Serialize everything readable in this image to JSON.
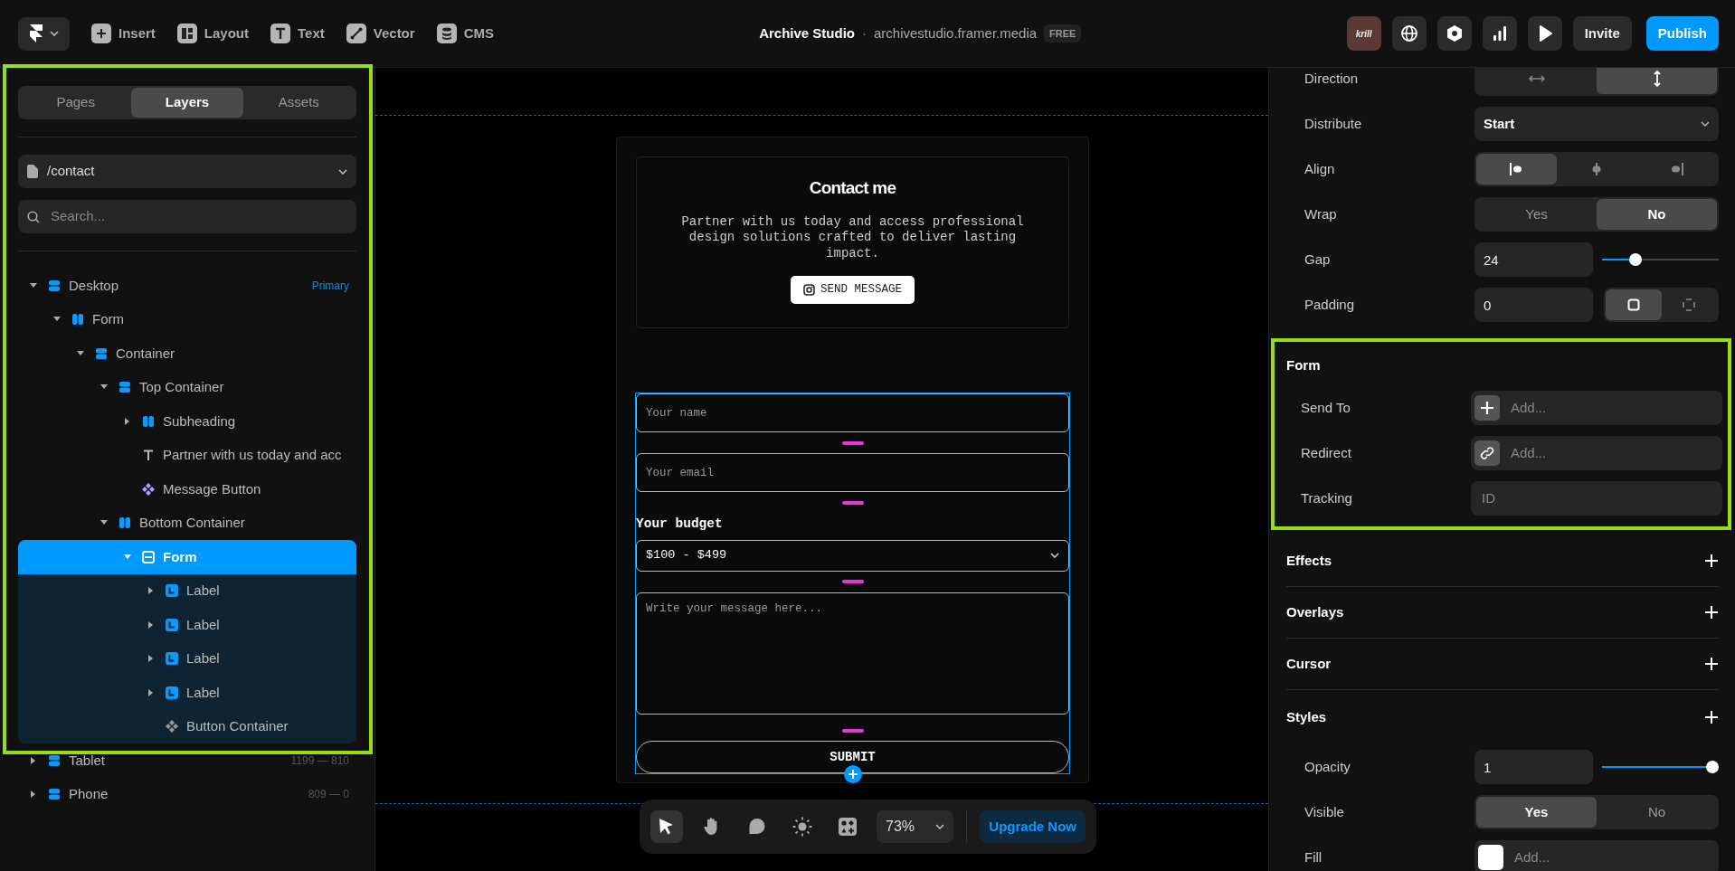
{
  "topbar": {
    "tools": [
      {
        "kind": "insert",
        "label": "Insert"
      },
      {
        "kind": "layout",
        "label": "Layout"
      },
      {
        "kind": "text",
        "label": "Text"
      },
      {
        "kind": "vector",
        "label": "Vector"
      },
      {
        "kind": "cms",
        "label": "CMS"
      }
    ],
    "project": {
      "name": "Archive Studio",
      "separator": "·",
      "domain": "archivestudio.framer.media",
      "plan": "FREE"
    },
    "avatar": "krill",
    "actions": [
      {
        "kind": "globe"
      },
      {
        "kind": "hexagon"
      },
      {
        "kind": "chart"
      },
      {
        "kind": "play"
      },
      {
        "kind": "text",
        "label": "Invite"
      },
      {
        "kind": "primary",
        "label": "Publish"
      }
    ]
  },
  "left_panel": {
    "highlighted": true,
    "tabs": [
      {
        "label": "Pages",
        "selected": false
      },
      {
        "label": "Layers",
        "selected": true
      },
      {
        "label": "Assets",
        "selected": false
      }
    ],
    "page": "/contact",
    "search": {
      "placeholder": "Search..."
    },
    "layers": [
      {
        "label": "Desktop",
        "kind": "stack",
        "meta": "Primary",
        "expanded": true,
        "selected": false,
        "children": [
          {
            "label": "Form",
            "kind": "columns",
            "expanded": true,
            "selected": false,
            "children": [
              {
                "label": "Container",
                "kind": "stack",
                "expanded": true,
                "selected": false,
                "children": [
                  {
                    "label": "Top Container",
                    "kind": "stack",
                    "expanded": true,
                    "selected": false,
                    "children": [
                      {
                        "label": "Subheading",
                        "kind": "columns",
                        "expanded": false,
                        "selected": false
                      },
                      {
                        "label": "Partner with us today and acc",
                        "kind": "text",
                        "selected": false
                      },
                      {
                        "label": "Message Button",
                        "kind": "component",
                        "selected": false
                      }
                    ]
                  },
                  {
                    "label": "Bottom Container",
                    "kind": "columns",
                    "expanded": true,
                    "selected": false,
                    "children": [
                      {
                        "label": "Form",
                        "kind": "form",
                        "expanded": true,
                        "selected": true,
                        "children": [
                          {
                            "label": "Label",
                            "kind": "label",
                            "expanded": false,
                            "selected": false
                          },
                          {
                            "label": "Label",
                            "kind": "label",
                            "expanded": false,
                            "selected": false
                          },
                          {
                            "label": "Label",
                            "kind": "label",
                            "expanded": false,
                            "selected": false
                          },
                          {
                            "label": "Label",
                            "kind": "label",
                            "expanded": false,
                            "selected": false
                          },
                          {
                            "label": "Button Container",
                            "kind": "component-muted",
                            "selected": false
                          }
                        ]
                      }
                    ]
                  }
                ]
              }
            ]
          }
        ]
      },
      {
        "label": "Tablet",
        "kind": "stack",
        "meta": "1199 — 810",
        "expanded": false,
        "selected": false
      },
      {
        "label": "Phone",
        "kind": "stack",
        "meta": "809 — 0",
        "expanded": false,
        "selected": false
      }
    ]
  },
  "canvas": {
    "heading": "Contact me",
    "text": "Partner with us today and access professional design solutions crafted to deliver lasting impact.",
    "button": "SEND MESSAGE",
    "form": {
      "selected": true,
      "fields": [
        {
          "kind": "input",
          "placeholder": "Your name"
        },
        {
          "kind": "input",
          "placeholder": "Your email"
        },
        {
          "kind": "select",
          "label": "Your budget",
          "value": "$100 - $499"
        },
        {
          "kind": "textarea",
          "placeholder": "Write your message here..."
        }
      ],
      "submit": "SUBMIT"
    }
  },
  "bottom_toolbar": {
    "tools": [
      {
        "kind": "pointer",
        "selected": true
      },
      {
        "kind": "hand",
        "selected": false
      },
      {
        "kind": "comment",
        "selected": false
      },
      {
        "kind": "sun",
        "selected": false
      },
      {
        "kind": "components",
        "selected": false
      }
    ],
    "zoom": "73%",
    "upgrade": "Upgrade Now"
  },
  "inspector": {
    "rows": [
      {
        "label": "Direction",
        "kind": "segmented",
        "options": [
          {
            "kind": "arrows-horizontal",
            "selected": false
          },
          {
            "kind": "arrows-vertical",
            "selected": true
          }
        ]
      },
      {
        "label": "Distribute",
        "kind": "select",
        "value": "Start"
      },
      {
        "label": "Align",
        "kind": "segmented",
        "options": [
          {
            "kind": "align-left",
            "selected": true
          },
          {
            "kind": "align-center",
            "selected": false
          },
          {
            "kind": "align-right",
            "selected": false
          }
        ]
      },
      {
        "label": "Wrap",
        "kind": "segmented",
        "options": [
          {
            "label": "Yes",
            "selected": false
          },
          {
            "label": "No",
            "selected": true
          }
        ]
      },
      {
        "label": "Gap",
        "kind": "slider",
        "value": "24",
        "level": 0.26
      },
      {
        "label": "Padding",
        "kind": "number-segmented",
        "value": "0",
        "options": [
          {
            "kind": "uniform",
            "selected": true
          },
          {
            "kind": "per-side",
            "selected": false
          }
        ]
      }
    ],
    "sections": [
      {
        "title": "Form",
        "highlighted": true,
        "addable": false,
        "rows": [
          {
            "label": "Send To",
            "kind": "add-field",
            "placeholder": "Add..."
          },
          {
            "label": "Redirect",
            "kind": "link-field",
            "placeholder": "Add..."
          },
          {
            "label": "Tracking",
            "kind": "text-field",
            "placeholder": "ID"
          }
        ]
      },
      {
        "title": "Effects",
        "highlighted": false,
        "addable": true
      },
      {
        "title": "Overlays",
        "highlighted": false,
        "addable": true
      },
      {
        "title": "Cursor",
        "highlighted": false,
        "addable": true
      },
      {
        "title": "Styles",
        "highlighted": false,
        "addable": true,
        "rows": [
          {
            "label": "Opacity",
            "kind": "slider",
            "value": "1",
            "level": 1
          },
          {
            "label": "Visible",
            "kind": "segmented",
            "options": [
              {
                "label": "Yes",
                "selected": true
              },
              {
                "label": "No",
                "selected": false
              }
            ]
          },
          {
            "label": "Fill",
            "kind": "color-field",
            "color": "#ffffff",
            "placeholder": "Add..."
          }
        ]
      }
    ]
  }
}
